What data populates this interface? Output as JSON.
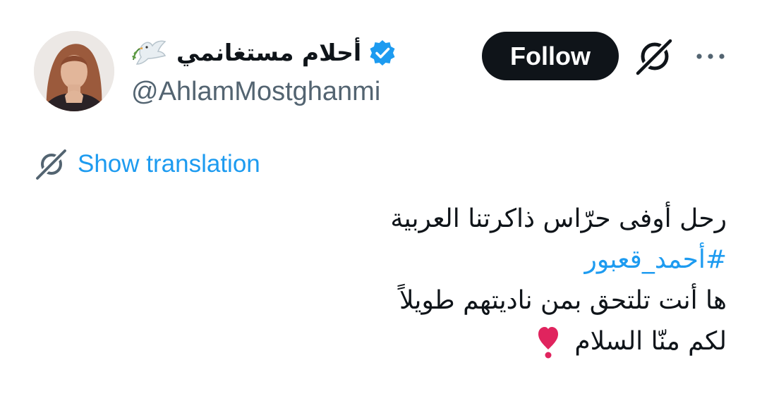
{
  "header": {
    "display_name": "أحلام مستغانمي",
    "handle": "@AhlamMostghanmi",
    "follow_label": "Follow",
    "icons": {
      "dove": "dove-with-olive-branch-icon",
      "verified": "verified-badge-icon",
      "grok": "grok-icon",
      "more": "more-dots-icon"
    },
    "verified_color": "#1d9bf0"
  },
  "translation": {
    "label": "Show translation",
    "icon": "translate-icon"
  },
  "tweet": {
    "line1": "رحل أوفى حرّاس ذاكرتنا  العربية",
    "hashtag": "#أحمد_قعبور",
    "line3": "ها أنت تلتحق بمن ناديتهم طويلاً",
    "line4": "لكم منّا السلام",
    "emoji": "heart-exclamation-icon"
  },
  "colors": {
    "text": "#0f1419",
    "secondary": "#536471",
    "link": "#1d9bf0",
    "follow_bg": "#0f1419",
    "heart": "#e0245e"
  }
}
